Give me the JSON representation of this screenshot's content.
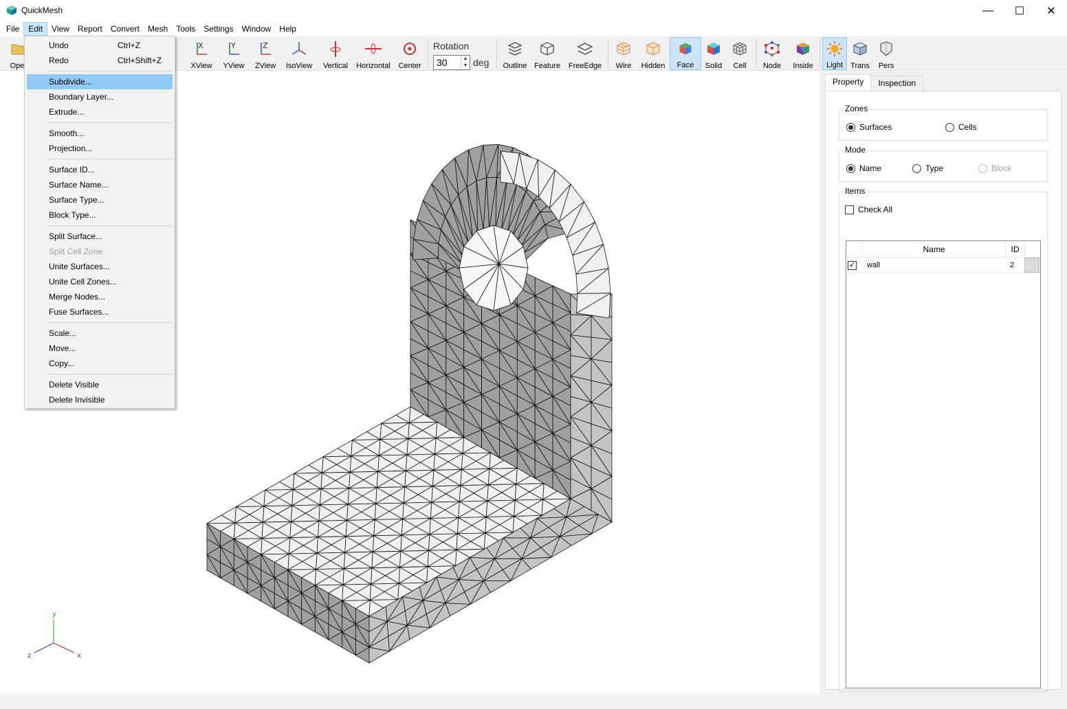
{
  "window": {
    "title": "QuickMesh"
  },
  "menubar": [
    "File",
    "Edit",
    "View",
    "Report",
    "Convert",
    "Mesh",
    "Tools",
    "Settings",
    "Window",
    "Help"
  ],
  "toolbar": {
    "open_label_partial": "Ope",
    "view_buttons": [
      "XView",
      "YView",
      "ZView",
      "IsoView",
      "Vertical",
      "Horizontal",
      "Center"
    ],
    "rotation": {
      "label": "Rotation",
      "value": "30",
      "unit": "deg"
    },
    "display_buttons": [
      "Outline",
      "Feature",
      "FreeEdge"
    ],
    "render_buttons": [
      "Wire",
      "Hidden",
      "Face",
      "Solid",
      "Cell"
    ],
    "other_buttons": [
      "Node",
      "Inside"
    ],
    "light_buttons": [
      "Light",
      "Trans",
      "Pers"
    ],
    "pressed": [
      "Face",
      "Light"
    ]
  },
  "edit_menu": {
    "items": [
      {
        "label": "Undo",
        "shortcut": "Ctrl+Z"
      },
      {
        "label": "Redo",
        "shortcut": "Ctrl+Shift+Z"
      },
      {
        "label": "Subdivide...",
        "highlighted": true
      },
      {
        "label": "Boundary Layer..."
      },
      {
        "label": "Extrude..."
      },
      {
        "label": "Smooth..."
      },
      {
        "label": "Projection..."
      },
      {
        "label": "Surface ID..."
      },
      {
        "label": "Surface Name..."
      },
      {
        "label": "Surface Type..."
      },
      {
        "label": "Block Type..."
      },
      {
        "label": "Split Surface..."
      },
      {
        "label": "Split Cell Zone",
        "disabled": true
      },
      {
        "label": "Unite Surfaces..."
      },
      {
        "label": "Unite Cell Zones..."
      },
      {
        "label": "Merge Nodes..."
      },
      {
        "label": "Fuse Surfaces..."
      },
      {
        "label": "Scale..."
      },
      {
        "label": "Move..."
      },
      {
        "label": "Copy..."
      },
      {
        "label": "Delete Visible"
      },
      {
        "label": "Delete Invisible"
      }
    ]
  },
  "axes": {
    "y": "y",
    "z": "z",
    "x": "x"
  },
  "panel": {
    "tabs": [
      "Property",
      "Inspection"
    ],
    "active_tab": "Property",
    "zones": {
      "title": "Zones",
      "options": [
        "Surfaces",
        "Cells"
      ],
      "selected": "Surfaces"
    },
    "mode": {
      "title": "Mode",
      "options": [
        "Name",
        "Type",
        "Block"
      ],
      "selected": "Name",
      "disabled": [
        "Block"
      ]
    },
    "items": {
      "title": "Items",
      "check_all": "Check All",
      "columns": [
        "Name",
        "ID"
      ],
      "rows": [
        {
          "checked": true,
          "name": "wall",
          "id": "2"
        }
      ]
    }
  },
  "colors": {
    "accent": "#0078d7",
    "menu_highlight": "#91c9f7",
    "face_light": "#f0f0f0",
    "face_mid": "#c4c4c4",
    "face_dark": "#a0a0a0"
  }
}
